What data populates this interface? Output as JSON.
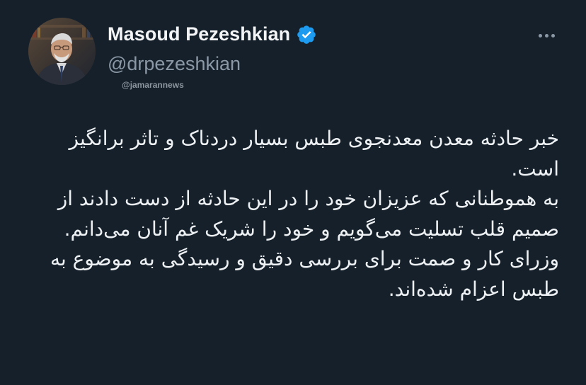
{
  "author": {
    "display_name": "Masoud Pezeshkian",
    "handle": "@drpezeshkian",
    "verified_icon": "verified-badge-icon",
    "avatar_icon": "avatar"
  },
  "watermark": "@jamarannews",
  "more_icon": "more-options-icon",
  "tweet": {
    "paragraphs": [
      "خبر حادثه معدن معدنجوی طبس بسیار دردناک و تاثر برانگیز است.",
      "به هموطنانی که عزیزان خود را در این حادثه از دست دادند از صمیم قلب تسلیت می‌گویم و خود را شریک غم آنان می‌دانم.",
      "وزرای کار و صمت برای بررسی دقیق و رسیدگی به موضوع به طبس اعزام شده‌اند."
    ]
  },
  "colors": {
    "background": "#15202b",
    "text": "#e7e9ea",
    "secondary": "#8b98a5",
    "verified": "#1d9bf0"
  }
}
